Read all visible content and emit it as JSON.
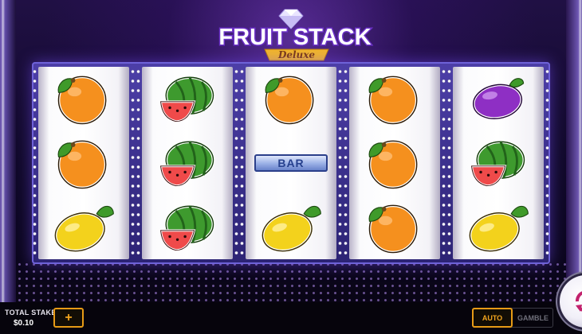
{
  "game": {
    "logo_title": "FRUIT STACK",
    "logo_subtitle": "Deluxe",
    "logo_gem_icon": "diamond-icon"
  },
  "reels": [
    [
      "orange",
      "orange",
      "lemon"
    ],
    [
      "watermelon",
      "watermelon",
      "watermelon"
    ],
    [
      "orange",
      "bar",
      "lemon"
    ],
    [
      "orange",
      "orange",
      "orange"
    ],
    [
      "plum",
      "watermelon",
      "lemon"
    ]
  ],
  "symbols": {
    "bar_label": "BAR"
  },
  "controls": {
    "total_stake_label": "TOTAL STAKE",
    "total_stake_value": "$0.10",
    "plus_label": "+",
    "auto_label": "AUTO",
    "gamble_label": "GAMBLE",
    "spin_icon": "spin-arrows-icon"
  },
  "colors": {
    "accent": "#e79b16",
    "background": "#120a2c",
    "logo_purple": "#7a3fd0",
    "logo_gold": "#f2b62a"
  }
}
